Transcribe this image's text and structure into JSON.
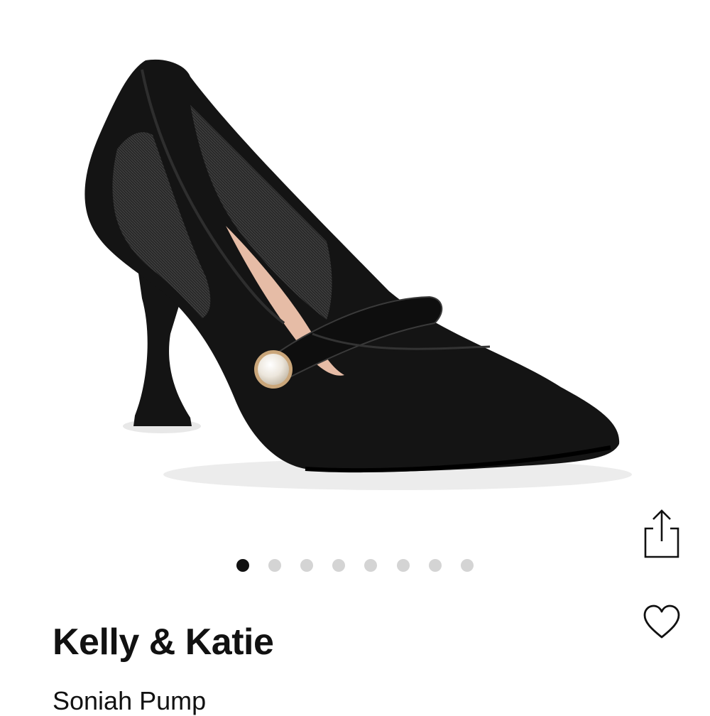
{
  "product": {
    "brand": "Kelly & Katie",
    "name": "Soniah Pump"
  },
  "carousel": {
    "total": 8,
    "active_index": 0
  },
  "actions": {
    "share_icon": "share-icon",
    "favorite_icon": "heart-icon"
  },
  "colors": {
    "active_dot": "#111111",
    "inactive_dot": "#d4d4d4",
    "shoe_suede": "#141414",
    "pearl": "#f1ede6",
    "lining": "#e6bca6"
  }
}
